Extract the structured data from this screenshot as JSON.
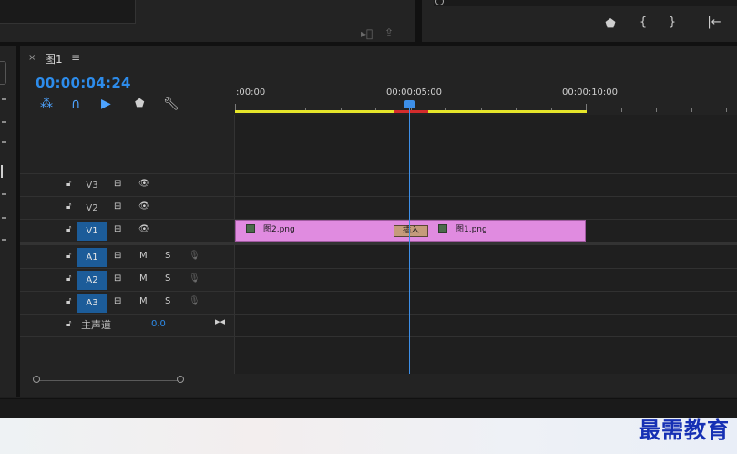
{
  "sequence": {
    "tab_label": "图1",
    "close_glyph": "×",
    "menu_glyph": "≡",
    "timecode": "00:00:04:24"
  },
  "ruler": {
    "labels": [
      ":00:00",
      "00:00:05:00",
      "00:00:10:00"
    ]
  },
  "tracks": [
    {
      "name": "V3",
      "type": "video",
      "active": false
    },
    {
      "name": "V2",
      "type": "video",
      "active": false
    },
    {
      "name": "V1",
      "type": "video",
      "active": true
    },
    {
      "name": "A1",
      "type": "audio",
      "active": true,
      "mute": "M",
      "solo": "S"
    },
    {
      "name": "A2",
      "type": "audio",
      "active": true,
      "mute": "M",
      "solo": "S"
    },
    {
      "name": "A3",
      "type": "audio",
      "active": true,
      "mute": "M",
      "solo": "S"
    }
  ],
  "master": {
    "label": "主声道",
    "value": "0.0"
  },
  "clips": [
    {
      "name": "图2.png",
      "track": "V1"
    },
    {
      "name": "图1.png",
      "track": "V1"
    }
  ],
  "transition_label": "插入",
  "watermark": "最需教育",
  "colors": {
    "timecode": "#2d8ceb",
    "clip": "#e08be0",
    "playhead": "#3d8fe8",
    "work_area": "#e5e52a",
    "track_active": "#1c5c99"
  }
}
